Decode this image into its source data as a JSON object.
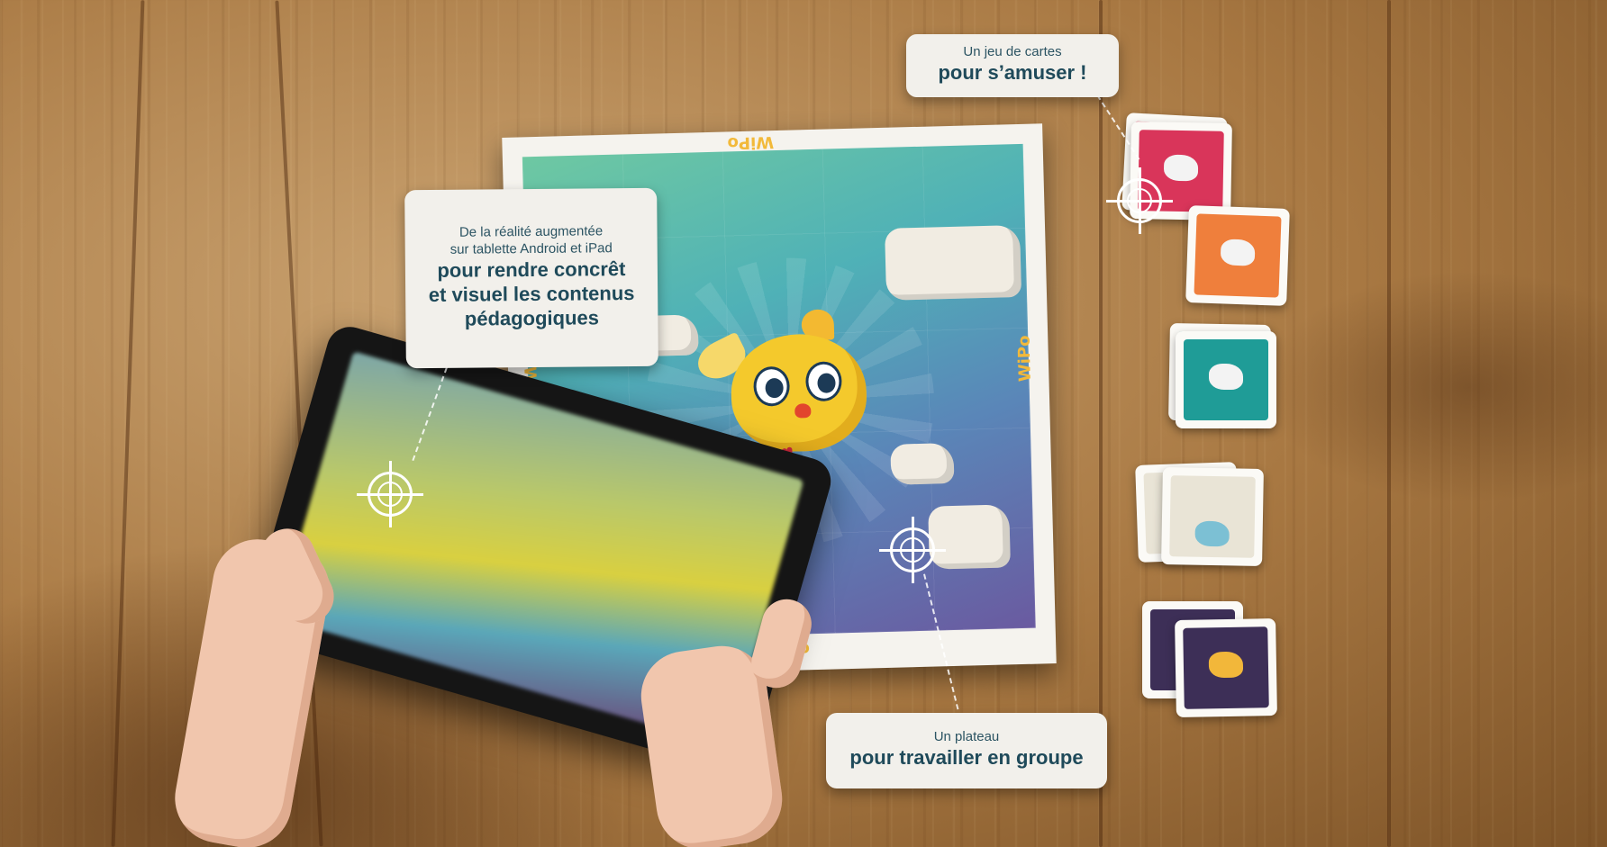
{
  "callouts": {
    "tablet": {
      "line1": "De la réalité augmentée",
      "line2": "sur tablette Android et iPad",
      "bold1": "pour rendre concrêt",
      "bold2": "et visuel les contenus",
      "bold3": "pédagogiques"
    },
    "cards": {
      "line1": "Un jeu de cartes",
      "bold1": "pour s’amuser !"
    },
    "board": {
      "line1": "Un plateau",
      "bold1": "pour travailler en groupe"
    }
  },
  "board": {
    "logo": "WiPo"
  },
  "cards": [
    {
      "color": "#d9355a",
      "icon": "cloud-icon"
    },
    {
      "color": "#ef7f3c",
      "icon": "rain-cloud-icon"
    },
    {
      "color": "#1f9c97",
      "icon": "snow-cloud-icon"
    },
    {
      "color": "#e9e4d6",
      "icon": "evaporation-icon"
    },
    {
      "color": "#3d2f57",
      "icon": "tree-icon"
    }
  ],
  "colors": {
    "callout_text": "#1f4a5a",
    "board_logo": "#f2b93a"
  }
}
